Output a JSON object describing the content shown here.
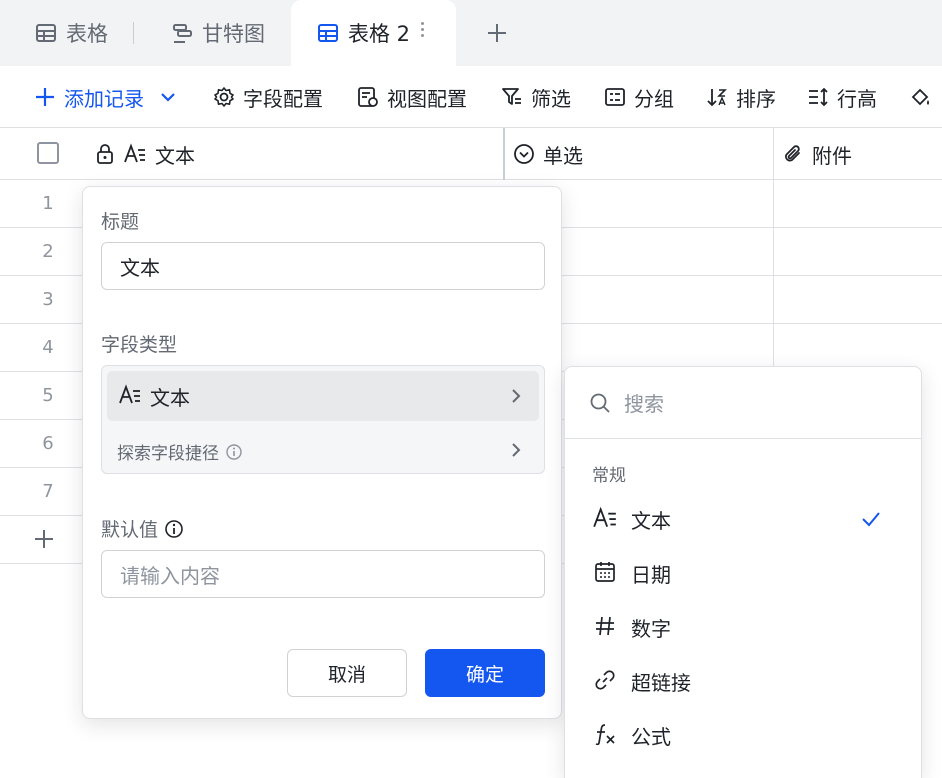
{
  "tabs": [
    {
      "label": "表格",
      "icon": "table-icon"
    },
    {
      "label": "甘特图",
      "icon": "gantt-icon"
    },
    {
      "label": "表格 2",
      "icon": "table-icon",
      "active": true
    }
  ],
  "toolbar": {
    "add_record": "添加记录",
    "field_config": "字段配置",
    "view_config": "视图配置",
    "filter": "筛选",
    "group": "分组",
    "sort": "排序",
    "row_height": "行高"
  },
  "columns": [
    {
      "label": "文本",
      "icon": "text-field-icon",
      "locked": true
    },
    {
      "label": "单选",
      "icon": "single-select-icon"
    },
    {
      "label": "附件",
      "icon": "attachment-icon"
    }
  ],
  "rows": [
    "1",
    "2",
    "3",
    "4",
    "5",
    "6",
    "7"
  ],
  "field_editor": {
    "title_label": "标题",
    "title_value": "文本",
    "type_label": "字段类型",
    "type_value": "文本",
    "explore_shortcut": "探索字段捷径",
    "default_label": "默认值",
    "default_placeholder": "请输入内容",
    "cancel": "取消",
    "confirm": "确定"
  },
  "type_menu": {
    "search_placeholder": "搜索",
    "group_label": "常规",
    "items": [
      {
        "label": "文本",
        "icon": "text-field-icon",
        "selected": true
      },
      {
        "label": "日期",
        "icon": "calendar-icon"
      },
      {
        "label": "数字",
        "icon": "hash-icon"
      },
      {
        "label": "超链接",
        "icon": "link-icon"
      },
      {
        "label": "公式",
        "icon": "formula-icon"
      }
    ]
  },
  "colors": {
    "accent": "#1456f0",
    "text": "#1f2329",
    "muted": "#646a73",
    "border": "#dee0e3",
    "tab_bg": "#f2f3f5"
  }
}
